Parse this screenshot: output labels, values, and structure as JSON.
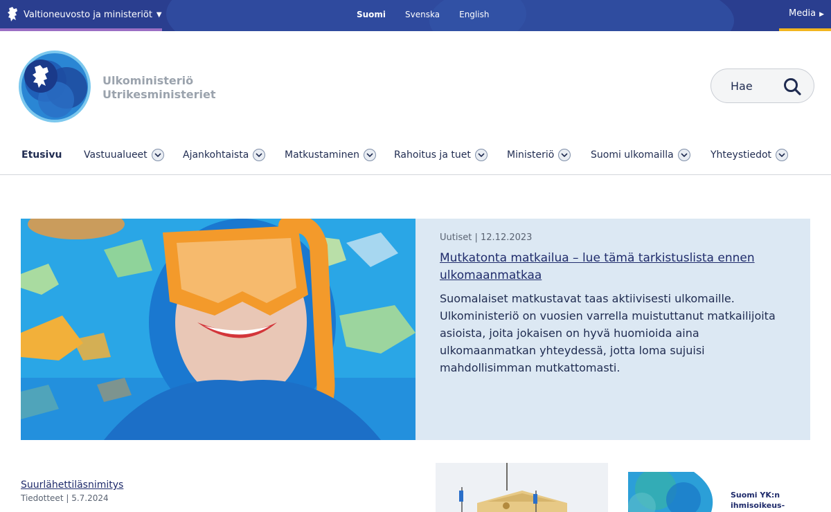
{
  "topbar": {
    "gov_label": "Valtioneuvosto ja ministeriöt",
    "languages": [
      "Suomi",
      "Svenska",
      "English"
    ],
    "active_language": "Suomi",
    "media_label": "Media"
  },
  "header": {
    "org_name_fi": "Ulkoministeriö",
    "org_name_sv": "Utrikesministeriet",
    "search_label": "Hae"
  },
  "nav": {
    "items": [
      {
        "label": "Etusivu"
      },
      {
        "label": "Vastuualueet"
      },
      {
        "label": "Ajankohtaista"
      },
      {
        "label": "Matkustaminen"
      },
      {
        "label": "Rahoitus ja tuet"
      },
      {
        "label": "Ministeriö"
      },
      {
        "label": "Suomi ulkomailla"
      },
      {
        "label": "Yhteystiedot"
      }
    ]
  },
  "hero": {
    "category": "Uutiset",
    "date": "12.12.2023",
    "title": "Mutkatonta matkailua – lue tämä tarkistuslista ennen ulkomaanmatkaa",
    "body": "Suomalaiset matkustavat taas aktiivisesti ulkomaille. Ulkoministeriö on vuosien varrella muistuttanut matkailijoita asioista, joita jokaisen on hyvä huomioida aina ulkomaanmatkan yhteydessä, jotta loma sujuisi mahdollisimman mutkattomasti."
  },
  "news": {
    "title": "Suurlähettiläsnimitys",
    "category": "Tiedotteet",
    "date": "5.7.2024"
  },
  "cards": {
    "card2_line1": "Suomi YK:n",
    "card2_line2": "ihmisoikeus-"
  },
  "colors": {
    "topbar": "#2a3e8f",
    "accent_purple": "#9b6fc4",
    "accent_yellow": "#f2b51f",
    "hero_panel": "#dce8f3",
    "link": "#1f2b6b"
  }
}
